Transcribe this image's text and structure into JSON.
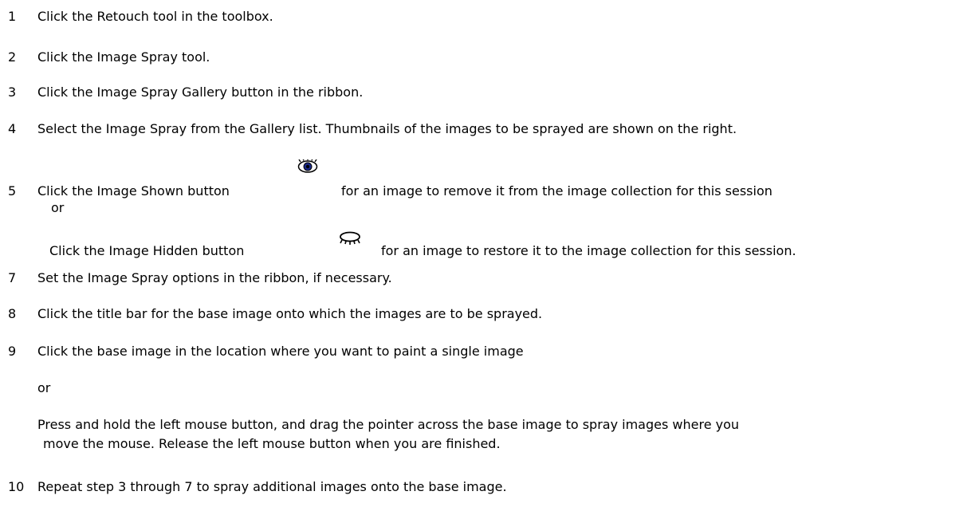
{
  "steps": [
    {
      "number": "1",
      "text": "Click the Retouch tool in the toolbox."
    },
    {
      "number": "2",
      "text": "Click the Image Spray tool."
    },
    {
      "number": "3",
      "text": "Click the Image Spray Gallery button in the ribbon."
    },
    {
      "number": "4",
      "text": "Select the Image Spray from the Gallery list. Thumbnails of the images to be sprayed are shown on the right."
    },
    {
      "number": "5",
      "text_before_icon": "Click the Image Shown button",
      "icon": "eye-icon",
      "text_after_icon": "for an image to remove it from the image collection for this session",
      "or": "or",
      "alt_before_icon": "Click the Image Hidden button",
      "alt_icon": "closed-eye-icon",
      "alt_after_icon": "for an image to restore it to the image collection for this session."
    },
    {
      "number": "7",
      "text": "Set the Image Spray options in the ribbon, if necessary."
    },
    {
      "number": "8",
      "text": "Click the title bar for the base image onto which the images are to be sprayed."
    },
    {
      "number": "9",
      "text": "Click the base image in the location where you want to paint a single image",
      "or": "or",
      "alt_line1": "Press and hold the left mouse button, and drag the pointer across the base image to spray images where you",
      "alt_line2": "move the mouse. Release the left mouse button when you are finished."
    },
    {
      "number": "10",
      "text": "Repeat step 3 through 7 to spray additional images onto the base image."
    }
  ]
}
